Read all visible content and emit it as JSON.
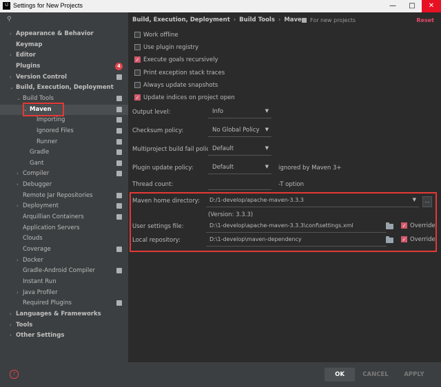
{
  "window": {
    "title": "Settings for New Projects",
    "app_icon_text": "IJ",
    "controls": {
      "minimize": "—",
      "maximize": "□",
      "close": "✕"
    }
  },
  "sidebar": {
    "search_placeholder": "",
    "items": [
      {
        "label": "Appearance & Behavior",
        "arrow": "›",
        "level": 0,
        "bold": true
      },
      {
        "label": "Keymap",
        "arrow": "",
        "level": 0,
        "bold": true
      },
      {
        "label": "Editor",
        "arrow": "›",
        "level": 0,
        "bold": true
      },
      {
        "label": "Plugins",
        "arrow": "",
        "level": 0,
        "bold": true,
        "badge": "4"
      },
      {
        "label": "Version Control",
        "arrow": "›",
        "level": 0,
        "bold": true,
        "project": true
      },
      {
        "label": "Build, Execution, Deployment",
        "arrow": "⌄",
        "level": 0,
        "bold": true
      },
      {
        "label": "Build Tools",
        "arrow": "⌄",
        "level": 1,
        "project": true
      },
      {
        "label": "Maven",
        "arrow": "⌄",
        "level": 2,
        "selected": true,
        "project": true
      },
      {
        "label": "Importing",
        "arrow": "",
        "level": 3,
        "project": true
      },
      {
        "label": "Ignored Files",
        "arrow": "",
        "level": 3,
        "project": true
      },
      {
        "label": "Runner",
        "arrow": "",
        "level": 3,
        "project": true
      },
      {
        "label": "Gradle",
        "arrow": "",
        "level": 2,
        "project": true
      },
      {
        "label": "Gant",
        "arrow": "",
        "level": 2,
        "project": true
      },
      {
        "label": "Compiler",
        "arrow": "›",
        "level": 1,
        "project": true
      },
      {
        "label": "Debugger",
        "arrow": "›",
        "level": 1
      },
      {
        "label": "Remote Jar Repositories",
        "arrow": "",
        "level": 1,
        "project": true
      },
      {
        "label": "Deployment",
        "arrow": "›",
        "level": 1,
        "project": true
      },
      {
        "label": "Arquillian Containers",
        "arrow": "",
        "level": 1,
        "project": true
      },
      {
        "label": "Application Servers",
        "arrow": "",
        "level": 1
      },
      {
        "label": "Clouds",
        "arrow": "",
        "level": 1
      },
      {
        "label": "Coverage",
        "arrow": "",
        "level": 1,
        "project": true
      },
      {
        "label": "Docker",
        "arrow": "›",
        "level": 1
      },
      {
        "label": "Gradle-Android Compiler",
        "arrow": "",
        "level": 1,
        "project": true
      },
      {
        "label": "Instant Run",
        "arrow": "",
        "level": 1
      },
      {
        "label": "Java Profiler",
        "arrow": "›",
        "level": 1
      },
      {
        "label": "Required Plugins",
        "arrow": "",
        "level": 1,
        "project": true
      },
      {
        "label": "Languages & Frameworks",
        "arrow": "›",
        "level": 0,
        "bold": true
      },
      {
        "label": "Tools",
        "arrow": "›",
        "level": 0,
        "bold": true
      },
      {
        "label": "Other Settings",
        "arrow": "›",
        "level": 0,
        "bold": true
      }
    ]
  },
  "header": {
    "crumbs": [
      "Build, Execution, Deployment",
      "Build Tools",
      "Maven"
    ],
    "for_new_projects": "For new projects",
    "reset": "Reset"
  },
  "options": [
    {
      "label": "Work offline",
      "checked": false
    },
    {
      "label": "Use plugin registry",
      "checked": false
    },
    {
      "label": "Execute goals recursively",
      "checked": true
    },
    {
      "label": "Print exception stack traces",
      "checked": false
    },
    {
      "label": "Always update snapshots",
      "checked": false
    },
    {
      "label": "Update indices on project open",
      "checked": true
    }
  ],
  "fields": {
    "output_level": {
      "label": "Output level:",
      "value": "Info"
    },
    "checksum_policy": {
      "label": "Checksum policy:",
      "value": "No Global Policy"
    },
    "multiproject_policy": {
      "label": "Multiproject build fail policy:",
      "value": "Default"
    },
    "plugin_update_policy": {
      "label": "Plugin update policy:",
      "value": "Default",
      "hint": "ignored by Maven 3+"
    },
    "thread_count": {
      "label": "Thread count:",
      "value": "",
      "hint": "-T option"
    }
  },
  "maven": {
    "home_label": "Maven home directory:",
    "home_value": "D:/1-develop/apache-maven-3.3.3",
    "version": "(Version: 3.3.3)",
    "user_settings_label": "User settings file:",
    "user_settings_value": "D:\\1-develop\\apache-maven-3.3.3\\conf\\settings.xml",
    "local_repo_label": "Local repository:",
    "local_repo_value": "D:\\1-develop\\maven-dependency",
    "override_label": "Override",
    "ellipsis": "..."
  },
  "footer": {
    "help": "?",
    "ok": "OK",
    "cancel": "CANCEL",
    "apply": "APPLY"
  },
  "colors": {
    "accent": "#d15a6c",
    "highlight_box": "#e53935",
    "reset": "#e8496a"
  }
}
